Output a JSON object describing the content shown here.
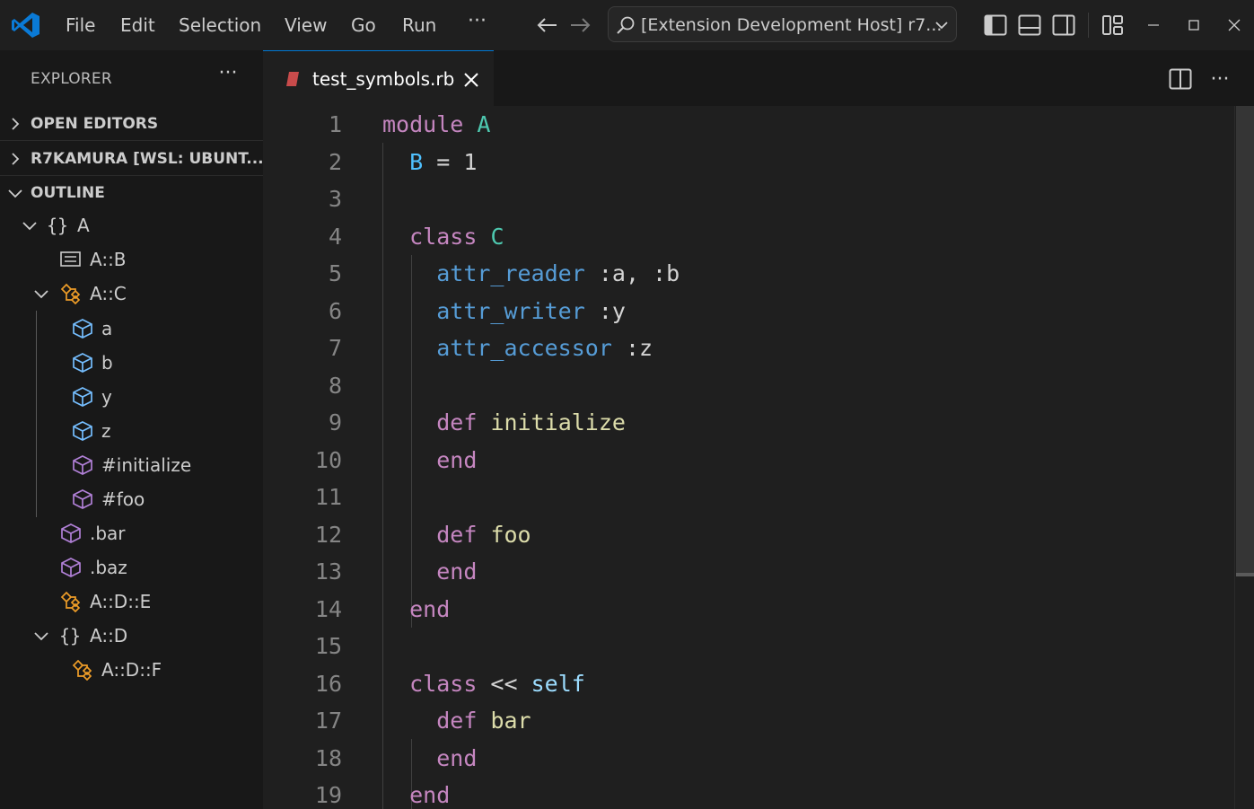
{
  "titlebar": {
    "menus": [
      "File",
      "Edit",
      "Selection",
      "View",
      "Go",
      "Run"
    ],
    "more_label": "···",
    "command_center_text": "[Extension Development Host] r7...",
    "icons": [
      "vscode-logo",
      "back-arrow",
      "forward-arrow",
      "search-icon",
      "chevron-down",
      "toggle-primary-sidebar",
      "toggle-panel",
      "toggle-secondary-sidebar",
      "customize-layout",
      "minimize",
      "maximize",
      "close"
    ]
  },
  "sidebar": {
    "header": "EXPLORER",
    "more_label": "···",
    "sections": {
      "open_editors": "OPEN EDITORS",
      "workspace": "R7KAMURA [WSL: UBUNT...",
      "outline": "OUTLINE"
    },
    "outline": [
      {
        "label": "A",
        "kind": "module",
        "expanded": true
      },
      {
        "label": "A::B",
        "kind": "constant"
      },
      {
        "label": "A::C",
        "kind": "class",
        "expanded": true
      },
      {
        "label": "a",
        "kind": "field"
      },
      {
        "label": "b",
        "kind": "field"
      },
      {
        "label": "y",
        "kind": "field"
      },
      {
        "label": "z",
        "kind": "field"
      },
      {
        "label": "#initialize",
        "kind": "method"
      },
      {
        "label": "#foo",
        "kind": "method"
      },
      {
        "label": ".bar",
        "kind": "method"
      },
      {
        "label": ".baz",
        "kind": "method"
      },
      {
        "label": "A::D::E",
        "kind": "class"
      },
      {
        "label": "A::D",
        "kind": "module",
        "expanded": true
      },
      {
        "label": "A::D::F",
        "kind": "class"
      }
    ]
  },
  "editor": {
    "tab_label": "test_symbols.rb",
    "tab_dirty_color": "#c84b4b",
    "lines": [
      {
        "n": "1",
        "tokens": [
          [
            "kw",
            "module"
          ],
          [
            "plain",
            " "
          ],
          [
            "const",
            "A"
          ]
        ]
      },
      {
        "n": "2",
        "tokens": [
          [
            "plain",
            "  "
          ],
          [
            "var",
            "B"
          ],
          [
            "plain",
            " = 1"
          ]
        ]
      },
      {
        "n": "3",
        "tokens": []
      },
      {
        "n": "4",
        "tokens": [
          [
            "plain",
            "  "
          ],
          [
            "kw",
            "class"
          ],
          [
            "plain",
            " "
          ],
          [
            "const",
            "C"
          ]
        ]
      },
      {
        "n": "5",
        "tokens": [
          [
            "plain",
            "    "
          ],
          [
            "builtin",
            "attr_reader"
          ],
          [
            "plain",
            " :a, :b"
          ]
        ]
      },
      {
        "n": "6",
        "tokens": [
          [
            "plain",
            "    "
          ],
          [
            "builtin",
            "attr_writer"
          ],
          [
            "plain",
            " :y"
          ]
        ]
      },
      {
        "n": "7",
        "tokens": [
          [
            "plain",
            "    "
          ],
          [
            "builtin",
            "attr_accessor"
          ],
          [
            "plain",
            " :z"
          ]
        ]
      },
      {
        "n": "8",
        "tokens": []
      },
      {
        "n": "9",
        "tokens": [
          [
            "plain",
            "    "
          ],
          [
            "kw",
            "def"
          ],
          [
            "plain",
            " "
          ],
          [
            "method",
            "initialize"
          ]
        ]
      },
      {
        "n": "10",
        "tokens": [
          [
            "plain",
            "    "
          ],
          [
            "kw",
            "end"
          ]
        ]
      },
      {
        "n": "11",
        "tokens": []
      },
      {
        "n": "12",
        "tokens": [
          [
            "plain",
            "    "
          ],
          [
            "kw",
            "def"
          ],
          [
            "plain",
            " "
          ],
          [
            "method",
            "foo"
          ]
        ]
      },
      {
        "n": "13",
        "tokens": [
          [
            "plain",
            "    "
          ],
          [
            "kw",
            "end"
          ]
        ]
      },
      {
        "n": "14",
        "tokens": [
          [
            "plain",
            "  "
          ],
          [
            "kw",
            "end"
          ]
        ]
      },
      {
        "n": "15",
        "tokens": []
      },
      {
        "n": "16",
        "tokens": [
          [
            "plain",
            "  "
          ],
          [
            "kw",
            "class"
          ],
          [
            "plain",
            " << "
          ],
          [
            "self",
            "self"
          ]
        ]
      },
      {
        "n": "17",
        "tokens": [
          [
            "plain",
            "    "
          ],
          [
            "kw",
            "def"
          ],
          [
            "plain",
            " "
          ],
          [
            "method",
            "bar"
          ]
        ]
      },
      {
        "n": "18",
        "tokens": [
          [
            "plain",
            "    "
          ],
          [
            "kw",
            "end"
          ]
        ]
      },
      {
        "n": "19",
        "tokens": [
          [
            "plain",
            "  "
          ],
          [
            "kw",
            "end"
          ]
        ]
      }
    ]
  },
  "colors": {
    "accent": "#0078d4",
    "keyword": "#c586c0",
    "constant": "#4ec9b0",
    "class_symbol": "#ee9d28",
    "field_symbol": "#75beff",
    "method_symbol": "#b180d7"
  }
}
